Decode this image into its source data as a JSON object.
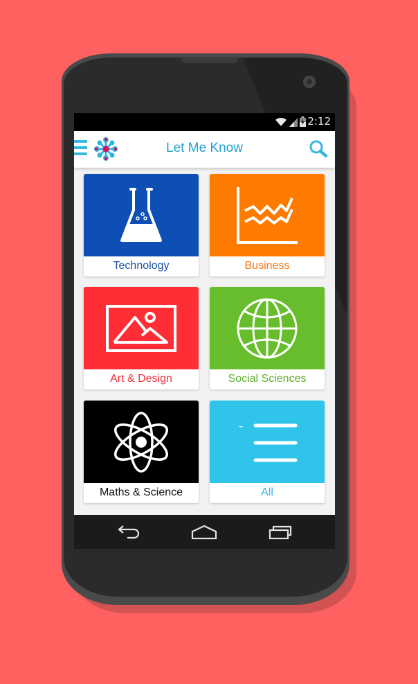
{
  "status_bar": {
    "time": "2:12",
    "icons": [
      "wifi-icon",
      "signal-icon",
      "battery-charging-icon"
    ]
  },
  "app_bar": {
    "title": "Let Me Know",
    "left_icons": [
      "menu-icon",
      "logo-icon"
    ],
    "right_icon": "search-icon"
  },
  "categories": [
    {
      "label": "Technology",
      "icon": "flask-icon",
      "color": "#0d4fb5",
      "label_color": "#1a4fa8"
    },
    {
      "label": "Business",
      "icon": "line-chart-icon",
      "color": "#ff7b00",
      "label_color": "#f07a10"
    },
    {
      "label": "Art & Design",
      "icon": "image-icon",
      "color": "#ff2e36",
      "label_color": "#f0333b"
    },
    {
      "label": "Social Sciences",
      "icon": "globe-icon",
      "color": "#67bd2b",
      "label_color": "#5fb030"
    },
    {
      "label": "Maths & Science",
      "icon": "atom-icon",
      "color": "#000000",
      "label_color": "#111111"
    },
    {
      "label": "All",
      "icon": "list-icon",
      "color": "#30c4eb",
      "label_color": "#30b8e6"
    }
  ],
  "nav_bar": {
    "buttons": [
      "back-icon",
      "home-icon",
      "recent-apps-icon"
    ]
  },
  "colors": {
    "background": "#ff6161",
    "accent": "#1f9fcf"
  }
}
